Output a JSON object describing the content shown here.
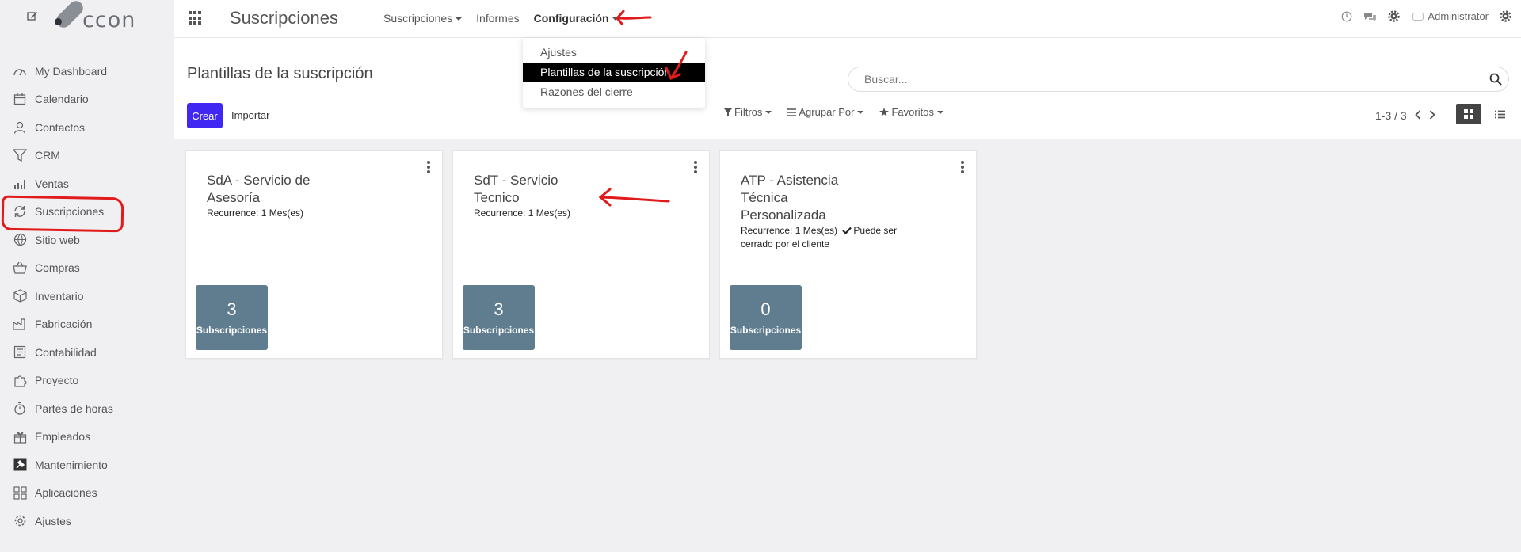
{
  "sidebar": {
    "logo_text": "ccon",
    "items": [
      {
        "label": "My Dashboard",
        "icon": "dashboard-icon"
      },
      {
        "label": "Calendario",
        "icon": "calendar-icon"
      },
      {
        "label": "Contactos",
        "icon": "user-icon"
      },
      {
        "label": "CRM",
        "icon": "funnel-icon"
      },
      {
        "label": "Ventas",
        "icon": "sales-chart-icon"
      },
      {
        "label": "Suscripciones",
        "icon": "refresh-icon"
      },
      {
        "label": "Sitio web",
        "icon": "globe-icon"
      },
      {
        "label": "Compras",
        "icon": "basket-icon"
      },
      {
        "label": "Inventario",
        "icon": "box-icon"
      },
      {
        "label": "Fabricación",
        "icon": "factory-icon"
      },
      {
        "label": "Contabilidad",
        "icon": "ledger-icon"
      },
      {
        "label": "Proyecto",
        "icon": "puzzle-icon"
      },
      {
        "label": "Partes de horas",
        "icon": "stopwatch-icon"
      },
      {
        "label": "Empleados",
        "icon": "gift-icon"
      },
      {
        "label": "Mantenimiento",
        "icon": "hammer-icon"
      },
      {
        "label": "Aplicaciones",
        "icon": "apps-grid-icon"
      },
      {
        "label": "Ajustes",
        "icon": "gear-icon"
      }
    ]
  },
  "topbar": {
    "app_title": "Suscripciones",
    "nav": {
      "suscripciones": "Suscripciones",
      "informes": "Informes",
      "configuracion": "Configuración"
    },
    "user_name": "Administrator"
  },
  "dropdown": {
    "items": [
      "Ajustes",
      "Plantillas de la suscripción",
      "Razones del cierre"
    ]
  },
  "control": {
    "breadcrumb": "Plantillas de la suscripción",
    "search_placeholder": "Buscar...",
    "create_label": "Crear",
    "import_label": "Importar",
    "filters_label": "Filtros",
    "groupby_label": "Agrupar Por",
    "favorites_label": "Favoritos",
    "pager": "1-3 / 3"
  },
  "cards": [
    {
      "title": "SdA - Servicio de Asesoría",
      "recurrence": "Recurrence: 1 Mes(es)",
      "count": "3",
      "count_label": "Subscripciones"
    },
    {
      "title": "SdT - Servicio Tecnico",
      "recurrence": "Recurrence: 1 Mes(es)",
      "count": "3",
      "count_label": "Subscripciones"
    },
    {
      "title": "ATP - Asistencia Técnica Personalizada",
      "recurrence": "Recurrence: 1 Mes(es)",
      "closable_note": "Puede ser cerrado por el cliente",
      "count": "0",
      "count_label": "Subscripciones"
    }
  ],
  "colors": {
    "primary": "#4027f2",
    "count_button": "#5f7d8e",
    "annotation": "#e11b1b",
    "dropdown_selected": "#000000"
  }
}
